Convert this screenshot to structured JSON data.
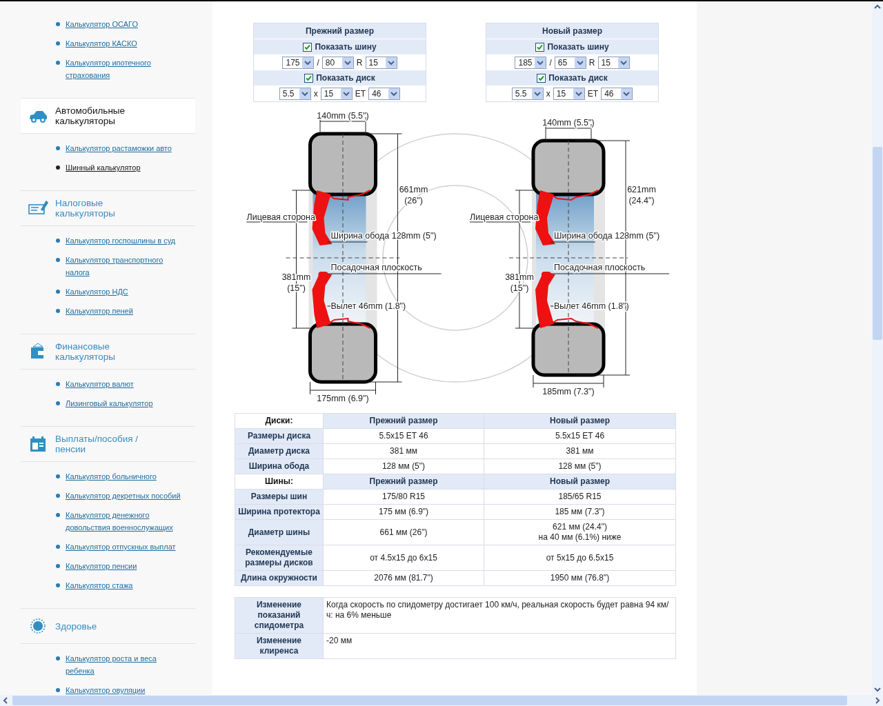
{
  "sidebar": {
    "groups": [
      {
        "links": [
          {
            "text": "Калькулятор ОСАГО",
            "selected": false
          },
          {
            "text": "Калькулятор КАСКО",
            "selected": false
          },
          {
            "text": "Калькулятор ипотечного страхования",
            "selected": false
          }
        ]
      },
      {
        "title": "Автомобильные калькуляторы",
        "kind": "car",
        "selected": true,
        "links": [
          {
            "text": "Калькулятор растаможки авто",
            "selected": false
          },
          {
            "text": "Шинный калькулятор",
            "selected": true
          }
        ]
      },
      {
        "title": "Налоговые калькуляторы",
        "kind": "tax",
        "selected": false,
        "links": [
          {
            "text": "Калькулятор госпошлины в суд",
            "selected": false
          },
          {
            "text": "Калькулятор транспортного налога",
            "selected": false
          },
          {
            "text": "Калькулятор НДС",
            "selected": false
          },
          {
            "text": "Калькулятор пеней",
            "selected": false
          }
        ]
      },
      {
        "title": "Финансовые калькуляторы",
        "kind": "wallet",
        "selected": false,
        "links": [
          {
            "text": "Калькулятор валют",
            "selected": false
          },
          {
            "text": "Лизинговый калькулятор",
            "selected": false
          }
        ]
      },
      {
        "title": "Выплаты/пособия /пенсии",
        "kind": "calendar",
        "selected": false,
        "links": [
          {
            "text": "Калькулятор больничного",
            "selected": false
          },
          {
            "text": "Калькулятор декретных пособий",
            "selected": false
          },
          {
            "text": "Калькулятор денежного довольствия военнослужащих",
            "selected": false
          },
          {
            "text": "Калькулятор отпускных выплат",
            "selected": false
          },
          {
            "text": "Калькулятор пенсии",
            "selected": false
          },
          {
            "text": "Калькулятор стажа",
            "selected": false
          }
        ]
      },
      {
        "title": "Здоровье",
        "kind": "sun",
        "selected": false,
        "links": [
          {
            "text": "Калькулятор роста и веса ребенка",
            "selected": false
          },
          {
            "text": "Калькулятор овуляции",
            "selected": false
          }
        ]
      }
    ]
  },
  "forms": [
    {
      "title": "Прежний размер",
      "tire": {
        "label": "Показать шину",
        "checked": true,
        "selects": [
          "175",
          "80",
          "15"
        ],
        "separators": [
          "/",
          "R"
        ]
      },
      "disk": {
        "label": "Показать диск",
        "checked": true,
        "selects": [
          "5.5",
          "15",
          "46"
        ],
        "separators": [
          "x",
          "ET"
        ]
      }
    },
    {
      "title": "Новый размер",
      "tire": {
        "label": "Показать шину",
        "checked": true,
        "selects": [
          "185",
          "65",
          "15"
        ],
        "separators": [
          "/",
          "R"
        ]
      },
      "disk": {
        "label": "Показать диск",
        "checked": true,
        "selects": [
          "5.5",
          "15",
          "46"
        ],
        "separators": [
          "x",
          "ET"
        ]
      }
    }
  ],
  "diagram": {
    "wheels": [
      {
        "top_width": "140mm (5.5\")",
        "diameter": [
          "661mm",
          "(26\")"
        ],
        "face": "Лицевая сторона",
        "rim_width": "Ширина обода 128mm (5\")",
        "seat": "Посадочная плоскость",
        "rim_diameter": [
          "381mm",
          "(15\")"
        ],
        "offset": "Вылет 46mm (1.8\")",
        "tire_width": "175mm (6.9\")"
      },
      {
        "top_width": "140mm (5.5\")",
        "diameter": [
          "621mm",
          "(24.4\")"
        ],
        "face": "Лицевая сторона",
        "rim_width": "Ширина обода  128mm (5\")",
        "seat": "Посадочная плоскость",
        "rim_diameter": [
          "381mm",
          "(15\")"
        ],
        "offset": "Вылет 46mm (1.8\")",
        "tire_width": "185mm (7.3\")"
      }
    ]
  },
  "comparison_table": {
    "rows": [
      {
        "kind": "header",
        "cells": [
          "Диски:",
          "Прежний размер",
          "Новый размер"
        ]
      },
      {
        "kind": "data",
        "cells": [
          "Размеры диска",
          "5.5x15 ET 46",
          "5.5x15 ET 46"
        ]
      },
      {
        "kind": "data",
        "cells": [
          "Диаметр диска",
          "381 мм",
          "381 мм"
        ]
      },
      {
        "kind": "data",
        "cells": [
          "Ширина обода",
          "128 мм (5\")",
          "128 мм (5\")"
        ]
      },
      {
        "kind": "header",
        "cells": [
          "Шины:",
          "Прежний размер",
          "Новый размер"
        ]
      },
      {
        "kind": "data",
        "cells": [
          "Размеры шин",
          "175/80 R15",
          "185/65 R15"
        ]
      },
      {
        "kind": "data",
        "cells": [
          "Ширина протектора",
          "175 мм (6.9\")",
          "185 мм (7.3\")"
        ]
      },
      {
        "kind": "data",
        "cells": [
          "Диаметр шины",
          "661 мм (26\")",
          "621 мм (24.4\")\nна 40 мм (6.1%) ниже"
        ]
      },
      {
        "kind": "data",
        "cells": [
          "Рекомендуемые размеры дисков",
          "от 4.5x15 до 6x15",
          "от 5x15 до 6.5x15"
        ]
      },
      {
        "kind": "data",
        "cells": [
          "Длина окружности",
          "2076 мм (81.7\")",
          "1950 мм (76.8\")"
        ]
      }
    ]
  },
  "changes_table": {
    "rows": [
      {
        "label": "Изменение показаний спидометра",
        "value": "Когда скорость по спидометру достигает 100 км/ч, реальная скорость будет равна 94 км/ч: на 6% меньше"
      },
      {
        "label": "Изменение клиренса",
        "value": "-20 мм"
      }
    ]
  }
}
